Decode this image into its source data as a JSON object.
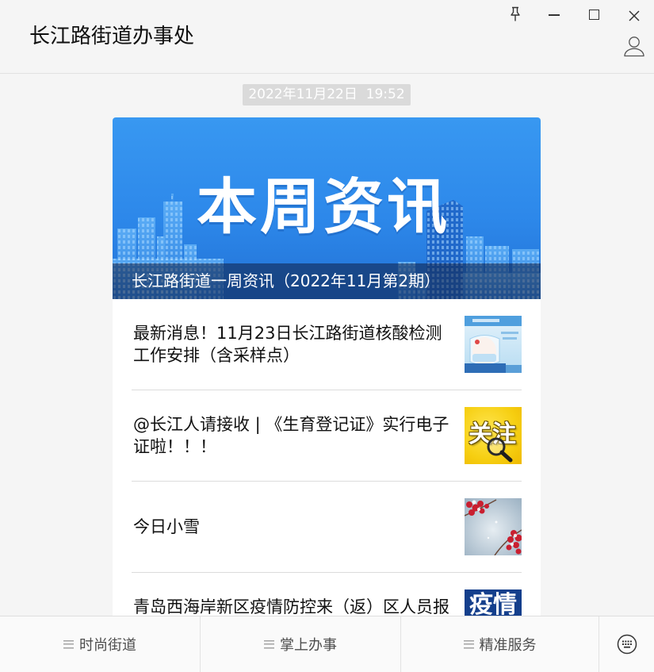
{
  "window": {
    "title": "长江路街道办事处",
    "controls": {
      "pin": "pin-icon",
      "minimize": "minimize-icon",
      "maximize": "maximize-icon",
      "close": "close-icon"
    },
    "profile_icon": "person-icon"
  },
  "chat": {
    "timestamp": "2022年11月22日  19:52",
    "article": {
      "banner": {
        "text": "本周资讯",
        "caption": "长江路街道一周资讯（2022年11月第2期）"
      },
      "items": [
        {
          "title": "最新消息！11月23日长江路街道核酸检测工作安排（含采样点）"
        },
        {
          "title": "@长江人请接收 | 《生育登记证》实行电子证啦！！！",
          "thumbnail_text": "关注"
        },
        {
          "title": "今日小雪"
        },
        {
          "title": "青岛西海岸新区疫情防控来（返）区人员报",
          "thumbnail_text": "疫情"
        }
      ]
    }
  },
  "menu": {
    "items": [
      {
        "label": "时尚街道",
        "icon": "menu-list-icon"
      },
      {
        "label": "掌上办事",
        "icon": "menu-list-icon"
      },
      {
        "label": "精准服务",
        "icon": "menu-list-icon"
      }
    ],
    "keyboard_icon": "keyboard-icon"
  },
  "colors": {
    "background": "#f5f5f5",
    "card": "#ffffff",
    "timestamp_bg": "#dadada",
    "banner_blue": "#2d88ea",
    "title_text": "#111111",
    "menu_text": "#4d4d4d"
  }
}
